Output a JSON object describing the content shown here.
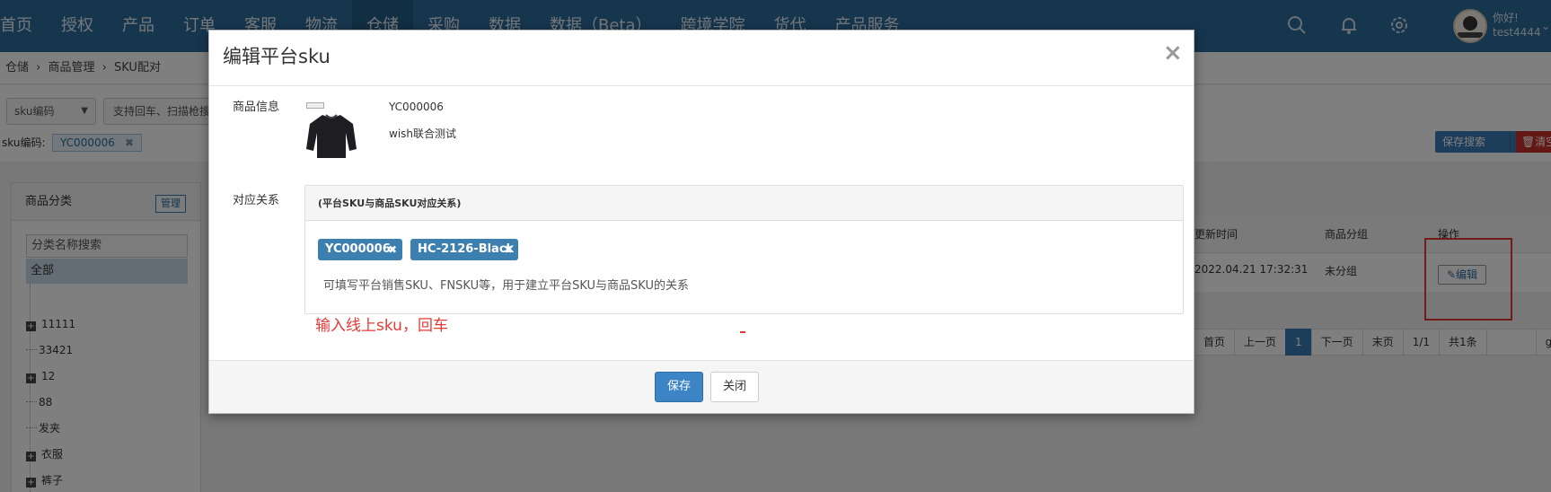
{
  "nav": {
    "items": [
      "首页",
      "授权",
      "产品",
      "订单",
      "客服",
      "物流",
      "仓储",
      "采购",
      "数据",
      "数据（Beta）",
      "跨境学院",
      "货代",
      "产品服务"
    ],
    "active_index": 6
  },
  "user": {
    "greeting": "你好!",
    "name": "test4444"
  },
  "breadcrumb": {
    "items": [
      "仓储",
      "商品管理",
      "SKU配对"
    ],
    "separator": "›"
  },
  "filters": {
    "select_value": "sku编码",
    "search_placeholder": "支持回车、扫描枪搜",
    "condition_label": "sku编码:",
    "condition_value": "YC000006"
  },
  "actions": {
    "save_search": "保存搜索",
    "clear": "清空"
  },
  "category_panel": {
    "title": "商品分类",
    "manage": "管理",
    "search_placeholder": "分类名称搜索",
    "all": "全部",
    "items": [
      {
        "label": "11111",
        "expandable": true
      },
      {
        "label": "33421",
        "expandable": false
      },
      {
        "label": "12",
        "expandable": true
      },
      {
        "label": "88",
        "expandable": false
      },
      {
        "label": "发夹",
        "expandable": false
      },
      {
        "label": "衣服",
        "expandable": true
      },
      {
        "label": "裤子",
        "expandable": true
      }
    ]
  },
  "table": {
    "headers": {
      "updated": "更新时间",
      "group": "商品分组",
      "ops": "操作"
    },
    "row": {
      "updated": "2022.04.21 17:32:31",
      "group": "未分组",
      "edit": "编辑"
    }
  },
  "pager": [
    "首页",
    "上一页",
    "1",
    "下一页",
    "末页",
    "1/1",
    "共1条",
    "",
    "go"
  ],
  "modal": {
    "title": "编辑平台sku",
    "close": "×",
    "product_label": "商品信息",
    "product_code": "YC000006",
    "product_name": "wish联合测试",
    "relation_label": "对应关系",
    "relation_header": "(平台SKU与商品SKU对应关系)",
    "chips": [
      "YC000006",
      "HC-2126-Black"
    ],
    "hint": "可填写平台销售SKU、FNSKU等，用于建立平台SKU与商品SKU的关系",
    "annotation": "输入线上sku，回车",
    "save": "保存",
    "cancel": "关闭"
  },
  "colors": {
    "nav": "#2d6d9c",
    "primary": "#3d84c6",
    "chip": "#3d80b0",
    "annotation": "#e53935"
  }
}
